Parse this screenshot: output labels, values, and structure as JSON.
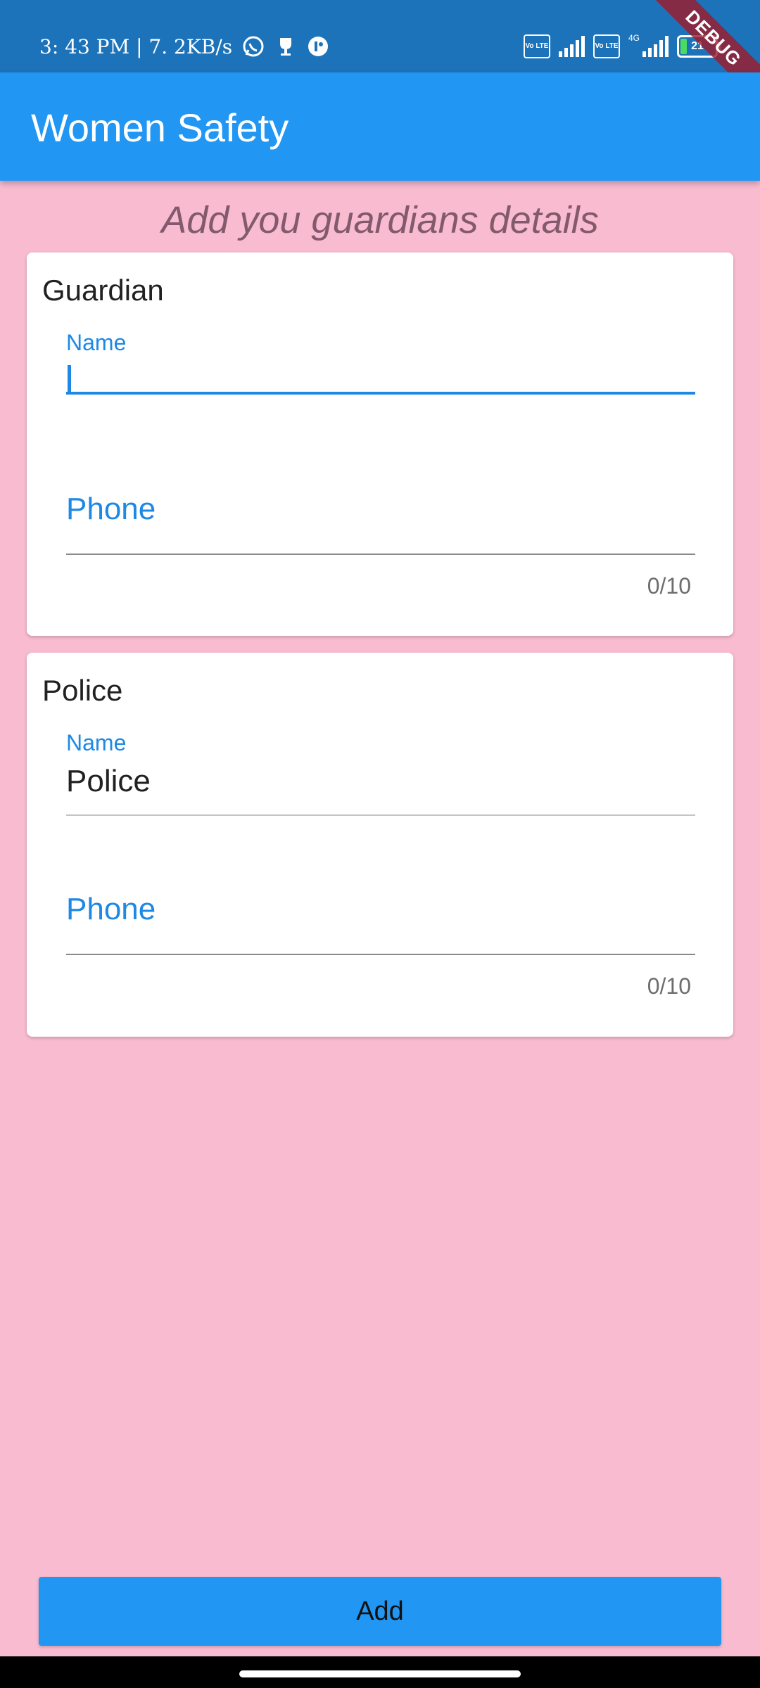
{
  "status_bar": {
    "time_speed": "3: 43 PM | 7. 2KB/s",
    "volte1": "Vo LTE",
    "volte2": "Vo LTE",
    "network": "4G",
    "battery": "21",
    "icons": [
      "whatsapp-icon",
      "trophy-icon",
      "app-icon",
      "signal-icon",
      "battery-icon"
    ]
  },
  "debug_banner": "DEBUG",
  "app_bar": {
    "title": "Women Safety"
  },
  "subtitle": "Add you guardians details",
  "cards": [
    {
      "title": "Guardian",
      "name_label": "Name",
      "name_value": "",
      "phone_placeholder": "Phone",
      "counter": "0/10"
    },
    {
      "title": "Police",
      "name_label": "Name",
      "name_value": "Police",
      "phone_placeholder": "Phone",
      "counter": "0/10"
    }
  ],
  "add_button": "Add",
  "colors": {
    "status_bar": "#1C73BA",
    "app_bar": "#2196F3",
    "background": "#F8BBD0",
    "accent": "#1E88E5"
  }
}
